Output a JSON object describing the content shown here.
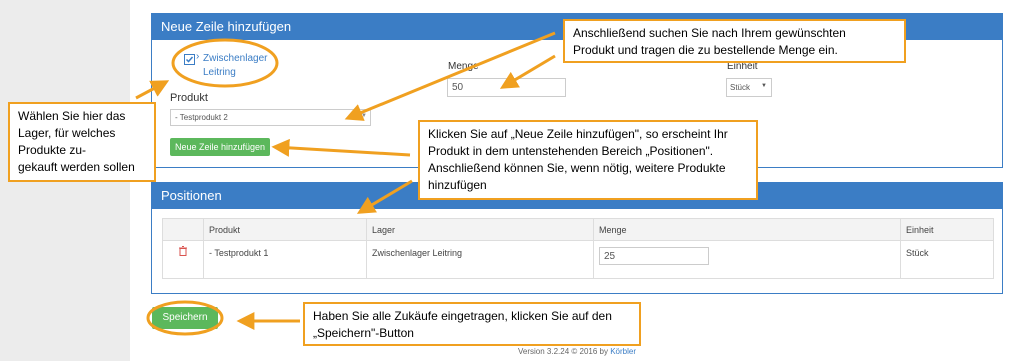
{
  "add_row_panel": {
    "title": "Neue Zeile hinzufügen",
    "tree_label_line1": "Zwischenlager",
    "tree_label_line2": "Leitring",
    "menge_label": "Menge",
    "menge_value": "50",
    "einheit_label": "Einheit",
    "einheit_value": "Stück",
    "produkt_label": "Produkt",
    "produkt_value": "- Testprodukt 2",
    "add_button": "Neue Zeile hinzufügen"
  },
  "positions_panel": {
    "title": "Positionen",
    "columns": [
      "Produkt",
      "Lager",
      "Menge",
      "Einheit"
    ],
    "rows": [
      {
        "produkt": "- Testprodukt 1",
        "lager": "Zwischenlager Leitring",
        "menge": "25",
        "einheit": "Stück"
      }
    ]
  },
  "save_button": "Speichern",
  "footer": {
    "version_text": "Version 3.2.24 © 2016 by",
    "company": "Körbler"
  },
  "callouts": {
    "lager_line1": "Wählen Sie hier das",
    "lager_line2": "Lager, für welches",
    "lager_line3": "Produkte zu-",
    "lager_line4": "gekauft werden sollen",
    "search_line1": "Anschließend  suchen Sie  nach Ihrem gewünschten",
    "search_line2": "Produkt und tragen die zu bestellende Menge ein.",
    "add_line1": "Klicken Sie auf „Neue Zeile hinzufügen\", so erscheint Ihr",
    "add_line2": "Produkt in dem untenstehenden  Bereich „Positionen\".",
    "add_line3": "Anschließend können Sie, wenn nötig, weitere Produkte",
    "add_line4": "hinzufügen",
    "save_line1": "Haben Sie alle Zukäufe eingetragen, klicken Sie auf den",
    "save_line2": "„Speichern\"-Button"
  },
  "colors": {
    "primary": "#3b7dc5",
    "success": "#5cb85c",
    "annotation": "#f0a020",
    "danger": "#d9534f"
  }
}
